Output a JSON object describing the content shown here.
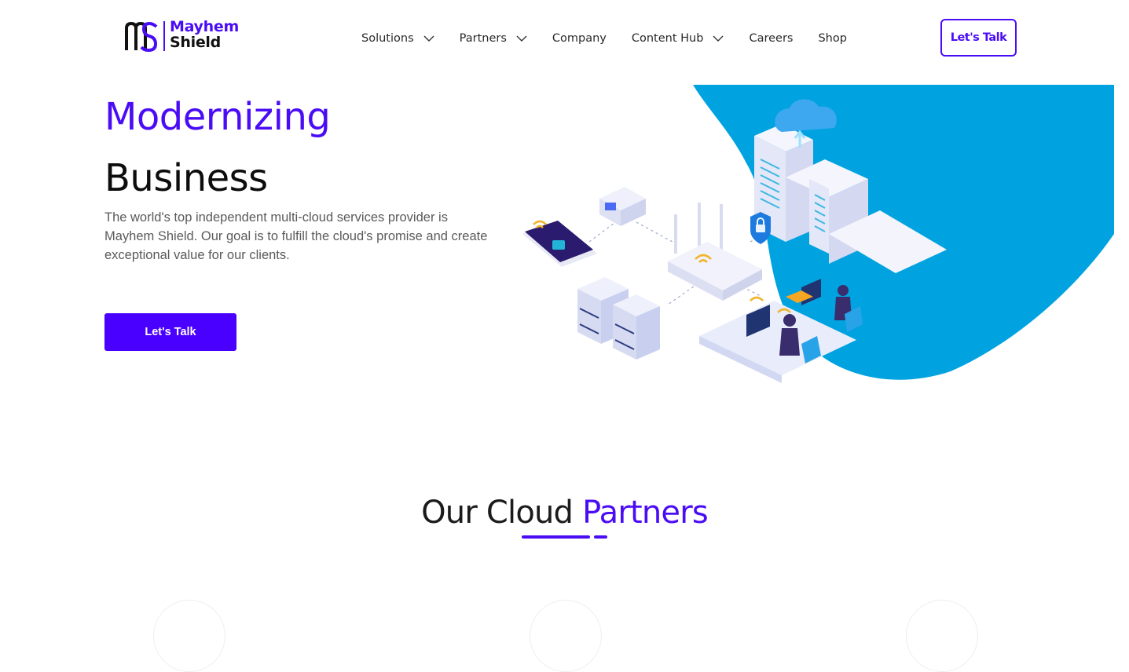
{
  "nav": {
    "logo": {
      "line1": "Mayhem",
      "line2": "Shield",
      "icon": "ms-monogram-icon"
    },
    "items": [
      {
        "label": "Solutions",
        "has_dropdown": true
      },
      {
        "label": "Partners",
        "has_dropdown": true
      },
      {
        "label": "Company",
        "has_dropdown": false
      },
      {
        "label": "Content Hub",
        "has_dropdown": true
      },
      {
        "label": "Careers",
        "has_dropdown": false
      },
      {
        "label": "Shop",
        "has_dropdown": false
      }
    ],
    "cta_label": "Let's Talk"
  },
  "hero": {
    "title_line1": "Modernizing",
    "title_line2": "Business",
    "description": "The world's top independent multi-cloud services provider is Mayhem Shield. Our goal is to fulfill the cloud's promise and create exceptional value for our clients.",
    "cta_label": "Let's Talk",
    "illustration": "cloud-network-illustration"
  },
  "partners": {
    "title_part1": "Our Cloud ",
    "title_part2": "Partners"
  },
  "colors": {
    "brand": "#4a0cf5",
    "button": "#4a00ff",
    "blob": "#00a3e0",
    "text_dark": "#0d0d0d",
    "text_muted": "#5a5a5a"
  }
}
